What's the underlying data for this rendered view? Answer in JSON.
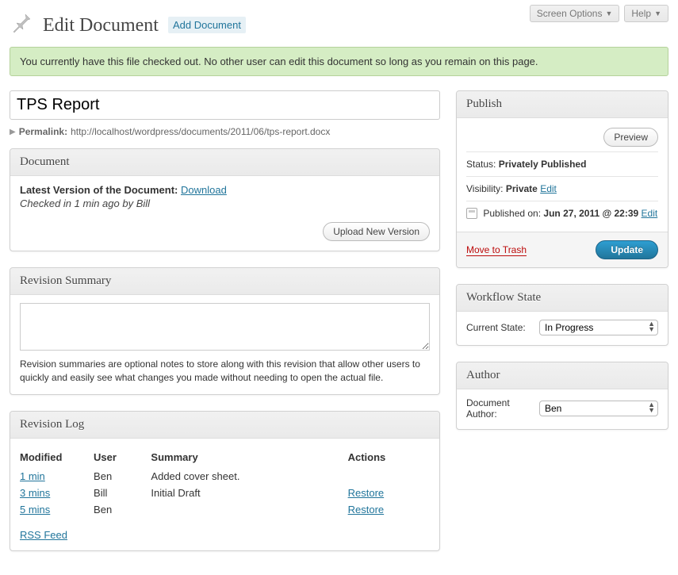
{
  "top": {
    "screen_options": "Screen Options",
    "help": "Help"
  },
  "header": {
    "title": "Edit Document",
    "add_new": "Add Document"
  },
  "notice": "You currently have this file checked out. No other user can edit this document so long as you remain on this page.",
  "post": {
    "title": "TPS Report",
    "permalink_label": "Permalink:",
    "permalink": "http://localhost/wordpress/documents/2011/06/tps-report.docx"
  },
  "document_box": {
    "heading": "Document",
    "latest_label": "Latest Version of the Document:",
    "download": "Download",
    "checked_in": "Checked in 1 min ago by Bill",
    "upload_btn": "Upload New Version"
  },
  "revision_summary_box": {
    "heading": "Revision Summary",
    "value": "",
    "help": "Revision summaries are optional notes to store along with this revision that allow other users to quickly and easily see what changes you made without needing to open the actual file."
  },
  "revision_log_box": {
    "heading": "Revision Log",
    "columns": {
      "modified": "Modified",
      "user": "User",
      "summary": "Summary",
      "actions": "Actions"
    },
    "rows": [
      {
        "modified": "1 min",
        "user": "Ben",
        "summary": "Added cover sheet.",
        "action": ""
      },
      {
        "modified": "3 mins",
        "user": "Bill",
        "summary": "Initial Draft",
        "action": "Restore"
      },
      {
        "modified": "5 mins",
        "user": "Ben",
        "summary": "",
        "action": "Restore"
      }
    ],
    "rss": "RSS Feed"
  },
  "publish_box": {
    "heading": "Publish",
    "preview": "Preview",
    "status_label": "Status:",
    "status_value": "Privately Published",
    "visibility_label": "Visibility:",
    "visibility_value": "Private",
    "edit": "Edit",
    "published_label": "Published on:",
    "published_value": "Jun 27, 2011 @ 22:39",
    "trash": "Move to Trash",
    "update": "Update"
  },
  "workflow_box": {
    "heading": "Workflow State",
    "label": "Current State:",
    "value": "In Progress"
  },
  "author_box": {
    "heading": "Author",
    "label": "Document Author:",
    "value": "Ben"
  }
}
